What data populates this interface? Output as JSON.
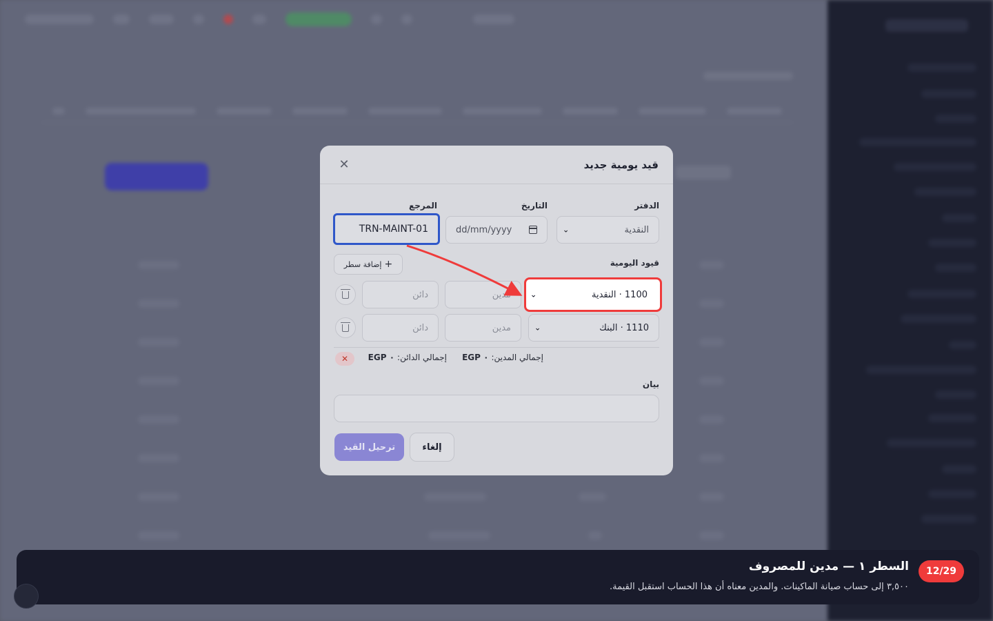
{
  "modal": {
    "title": "قيد يومية جديد",
    "fields": {
      "journal_label": "الدفتر",
      "journal_value": "النقدية",
      "date_label": "التاريخ",
      "date_value": "dd/mm/yyyy",
      "reference_label": "المرجع",
      "reference_value": "TRN-MAINT-01"
    },
    "entries_label": "قيود اليومية",
    "add_line_label": "إضافة سطر",
    "lines": [
      {
        "account": "1100 · النقدية",
        "debit_placeholder": "مدين",
        "credit_placeholder": "دائن"
      },
      {
        "account": "1110 · البنك",
        "debit_placeholder": "مدين",
        "credit_placeholder": "دائن"
      }
    ],
    "totals": {
      "debit_label": "إجمالي المدين:",
      "debit_value": "EGP ٠",
      "credit_label": "إجمالي الدائن:",
      "credit_value": "EGP ٠"
    },
    "description_label": "بيان",
    "buttons": {
      "post": "ترحيل القيد",
      "cancel": "إلغاء"
    }
  },
  "tutorial": {
    "step": "12/29",
    "title": "السطر ١ — مدين للمصروف",
    "text": "٣,٥٠٠ إلى حساب صيانة الماكينات. والمدين معناه أن هذا الحساب استقبل القيمة."
  },
  "colors": {
    "highlight": "#ef3b3b",
    "focus_border": "#2f57c9",
    "primary_button": "#8a86d4",
    "banner_bg": "#191b2b"
  }
}
